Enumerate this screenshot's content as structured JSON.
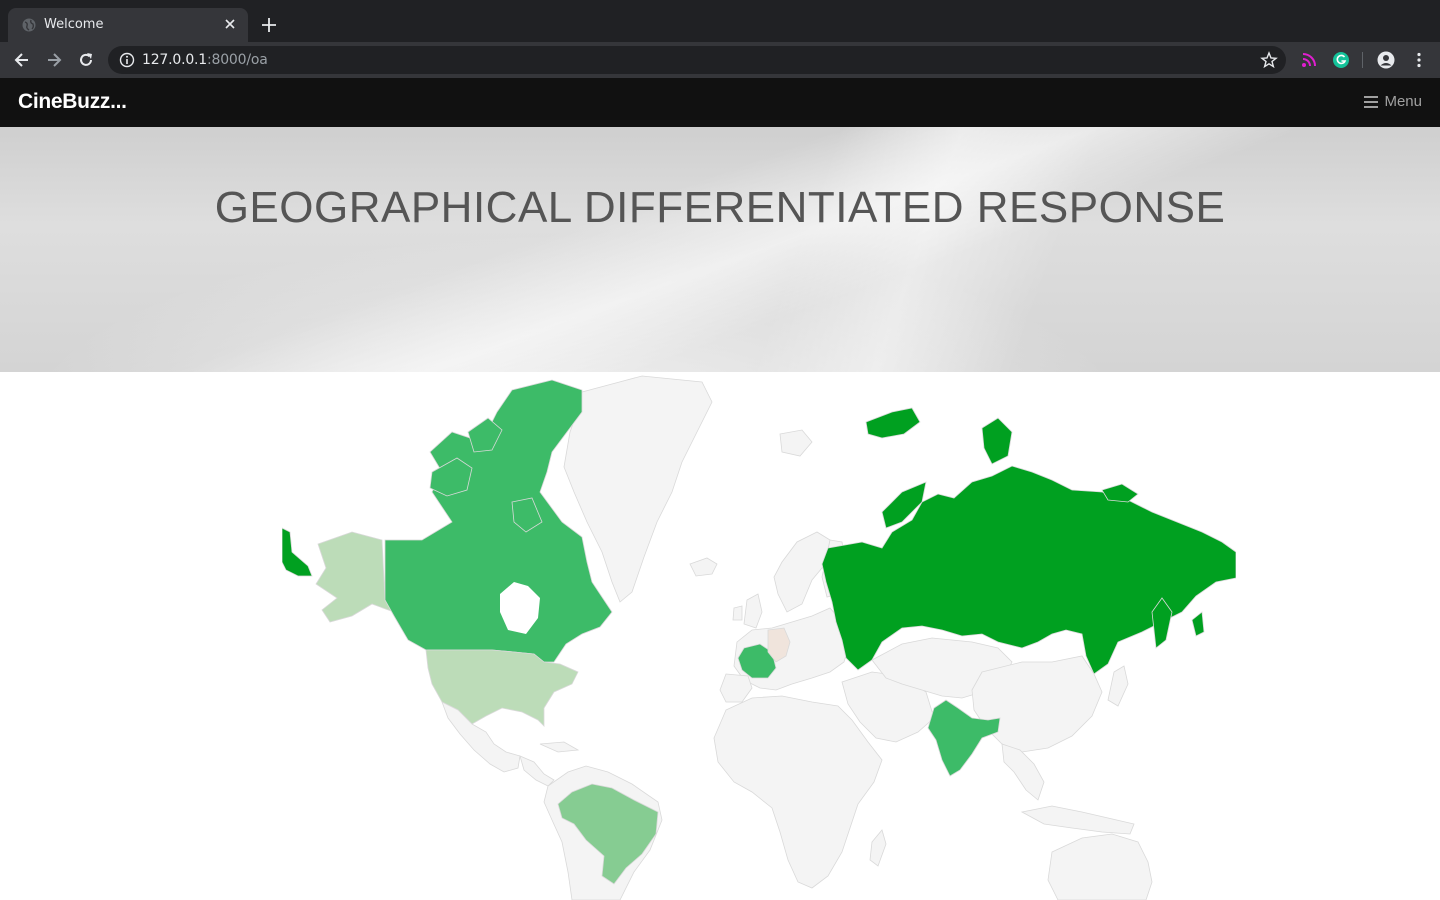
{
  "browser": {
    "tab_title": "Welcome",
    "url_host": "127.0.0.1",
    "url_path": ":8000/oa"
  },
  "navbar": {
    "brand": "CineBuzz...",
    "menu_label": "Menu",
    "menu_icon": "hamburger-icon"
  },
  "hero": {
    "title": "GEOGRAPHICAL DIFFERENTIATED RESPONSE"
  },
  "map": {
    "colors": {
      "no_data": "#f4f4f4",
      "border": "#d9d9d9",
      "strong": "#00a020",
      "medium": "#3dbb68",
      "light": "#86cc92",
      "lighter": "#bcdcb8",
      "neutral": "#f0e4dc"
    },
    "highlighted_countries": [
      {
        "name": "Russia",
        "shade": "strong"
      },
      {
        "name": "Canada",
        "shade": "medium"
      },
      {
        "name": "France",
        "shade": "medium"
      },
      {
        "name": "India",
        "shade": "medium"
      },
      {
        "name": "Brazil",
        "shade": "light"
      },
      {
        "name": "United States",
        "shade": "lighter"
      },
      {
        "name": "Germany",
        "shade": "neutral"
      }
    ]
  }
}
